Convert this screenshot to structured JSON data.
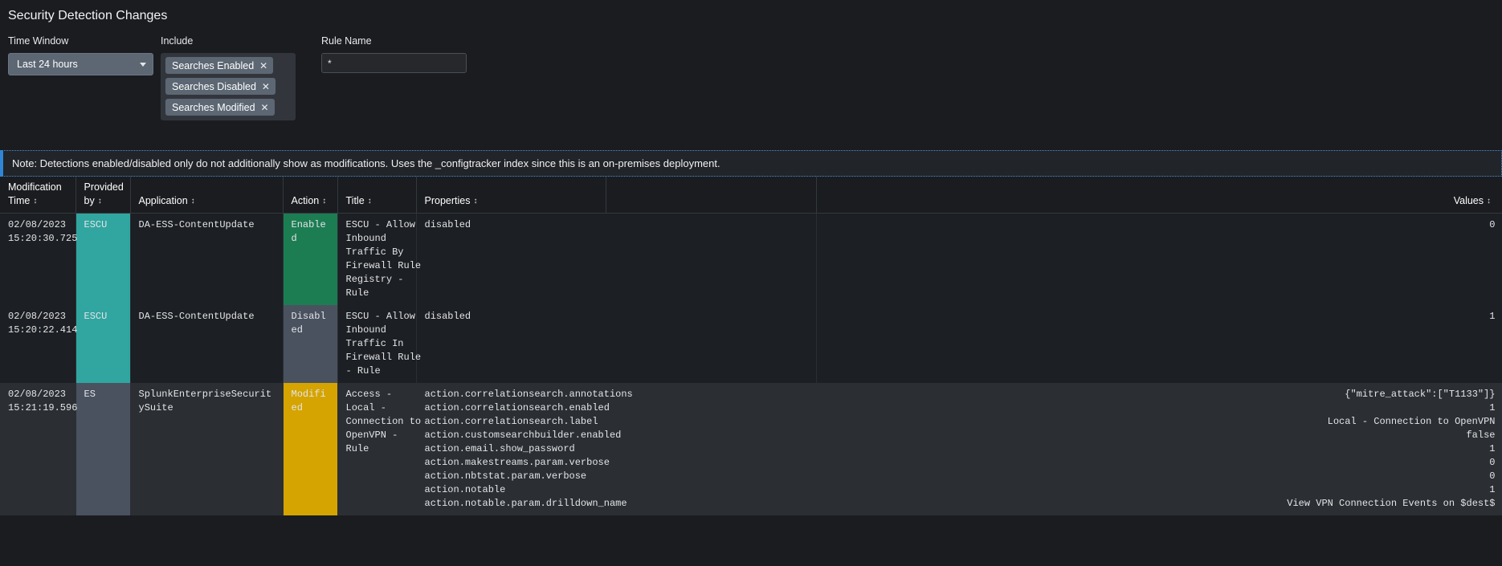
{
  "page": {
    "title": "Security Detection Changes"
  },
  "filters": {
    "time_window": {
      "label": "Time Window",
      "value": "Last 24 hours",
      "caret_icon": "chevron-down-icon"
    },
    "include": {
      "label": "Include",
      "chips": [
        {
          "label": "Searches Enabled",
          "remove_icon": "close-icon",
          "remove_glyph": "✕"
        },
        {
          "label": "Searches Disabled",
          "remove_icon": "close-icon",
          "remove_glyph": "✕"
        },
        {
          "label": "Searches Modified",
          "remove_icon": "close-icon",
          "remove_glyph": "✕"
        }
      ]
    },
    "rule_name": {
      "label": "Rule Name",
      "value": "*",
      "placeholder": ""
    }
  },
  "note": {
    "text": "Note: Detections enabled/disabled only do not additionally show as modifications. Uses the _configtracker index since this is an on-premises deployment.",
    "accent_color": "#2f86d4"
  },
  "table": {
    "sort_glyph": "↕",
    "columns": [
      {
        "label": "Modification Time",
        "align": "left"
      },
      {
        "label": "Provided by",
        "align": "left"
      },
      {
        "label": "Application",
        "align": "left"
      },
      {
        "label": "Action",
        "align": "left"
      },
      {
        "label": "Title",
        "align": "left"
      },
      {
        "label": "Properties",
        "align": "left"
      },
      {
        "label": "",
        "align": "left"
      },
      {
        "label": "Values",
        "align": "right"
      }
    ],
    "rows": [
      {
        "time": "02/08/2023\n15:20:30.725",
        "provided_by": "ESCU",
        "provider_style": "prov-escu",
        "application": "DA-ESS-ContentUpdate",
        "action": "Enabled",
        "action_style": "act-enabled",
        "title": "ESCU - Allow\nInbound\nTraffic By\nFirewall Rule\nRegistry -\nRule",
        "properties": "disabled",
        "values": "0"
      },
      {
        "time": "02/08/2023\n15:20:22.414",
        "provided_by": "ESCU",
        "provider_style": "prov-escu",
        "application": "DA-ESS-ContentUpdate",
        "action": "Disabled",
        "action_style": "act-disabled",
        "title": "ESCU - Allow\nInbound\nTraffic In\nFirewall Rule\n- Rule",
        "properties": "disabled",
        "values": "1"
      },
      {
        "time": "02/08/2023\n15:21:19.596",
        "provided_by": "ES",
        "provider_style": "prov-es",
        "application": "SplunkEnterpriseSecuritySuite",
        "action": "Modified",
        "action_style": "act-modified",
        "title": "Access -\nLocal -\nConnection to\nOpenVPN -\nRule",
        "properties": "action.correlationsearch.annotations\naction.correlationsearch.enabled\naction.correlationsearch.label\naction.customsearchbuilder.enabled\naction.email.show_password\naction.makestreams.param.verbose\naction.nbtstat.param.verbose\naction.notable\naction.notable.param.drilldown_name",
        "values": "{\"mitre_attack\":[\"T1133\"]}\n1\nLocal - Connection to OpenVPN\nfalse\n1\n0\n0\n1\nView VPN Connection Events on $dest$"
      }
    ]
  }
}
